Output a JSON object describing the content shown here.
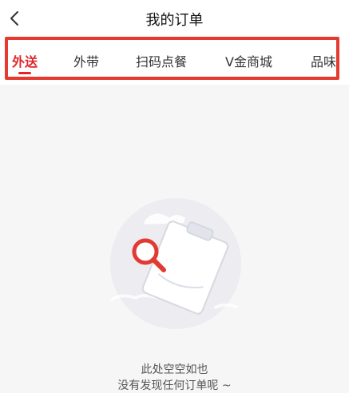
{
  "header": {
    "back_icon": "chevron-left-icon",
    "title": "我的订单"
  },
  "tabs": [
    {
      "label": "外送",
      "active": true
    },
    {
      "label": "外带",
      "active": false
    },
    {
      "label": "扫码点餐",
      "active": false
    },
    {
      "label": "V金商城",
      "active": false
    },
    {
      "label": "品味",
      "active": false
    }
  ],
  "empty_state": {
    "illustration_icon": "search-clipboard-icon",
    "line1": "此处空空如也",
    "line2": "没有发现任何订单呢 ~"
  },
  "colors": {
    "accent": "#e0262b",
    "highlight_border": "#e53a2f",
    "background": "#f6f6f6"
  }
}
